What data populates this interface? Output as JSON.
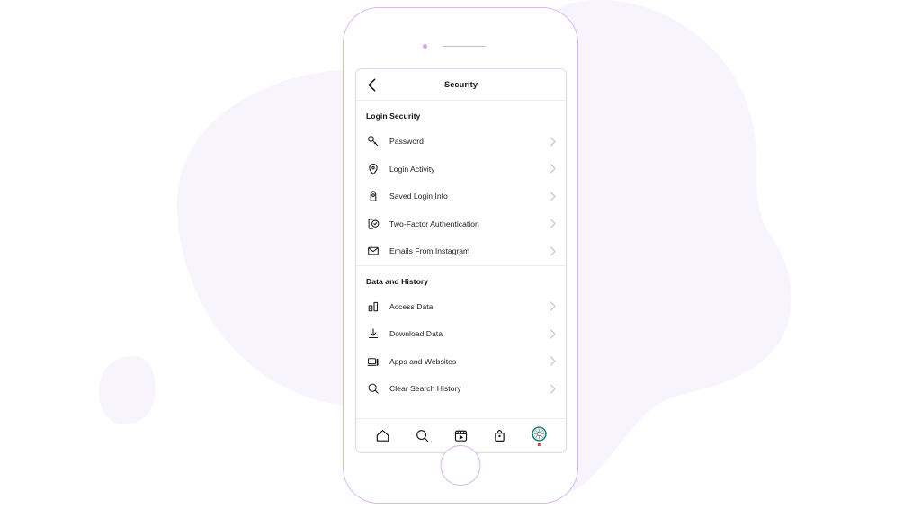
{
  "colors": {
    "background": "#ffffff",
    "blob_fill": "#f8f4fd",
    "phone_outline": "#d8b8f0",
    "screen_outline": "#e5d3f5",
    "text_primary": "#1e1e1e",
    "text_heading": "#121212",
    "chevron": "#cccccc",
    "divider": "#eceaee",
    "avatar_ring": "#14776f",
    "avatar_badge": "#e8383d"
  },
  "device": {
    "name": "smartphone-mockup",
    "camera": "camera-dot",
    "speaker": "speaker-grille",
    "home_button": "home-button"
  },
  "header": {
    "back_icon": "chevron-left-icon",
    "title": "Security"
  },
  "sections": [
    {
      "title": "Login Security",
      "items": [
        {
          "label": "Password",
          "icon": "key-icon",
          "chevron": "chevron-right-icon"
        },
        {
          "label": "Login Activity",
          "icon": "location-pin-icon",
          "chevron": "chevron-right-icon"
        },
        {
          "label": "Saved Login Info",
          "icon": "lock-keyhole-icon",
          "chevron": "chevron-right-icon"
        },
        {
          "label": "Two-Factor Authentication",
          "icon": "phone-shield-check-icon",
          "chevron": "chevron-right-icon"
        },
        {
          "label": "Emails From Instagram",
          "icon": "envelope-icon",
          "chevron": "chevron-right-icon"
        }
      ]
    },
    {
      "title": "Data and History",
      "items": [
        {
          "label": "Access Data",
          "icon": "bar-chart-icon",
          "chevron": "chevron-right-icon"
        },
        {
          "label": "Download Data",
          "icon": "download-icon",
          "chevron": "chevron-right-icon"
        },
        {
          "label": "Apps and Websites",
          "icon": "monitor-icon",
          "chevron": "chevron-right-icon"
        },
        {
          "label": "Clear Search History",
          "icon": "search-icon",
          "chevron": "chevron-right-icon"
        }
      ]
    }
  ],
  "tabbar": {
    "items": [
      {
        "name": "home-tab",
        "icon": "home-icon"
      },
      {
        "name": "search-tab",
        "icon": "search-icon"
      },
      {
        "name": "reels-tab",
        "icon": "reels-play-icon"
      },
      {
        "name": "shop-tab",
        "icon": "shopping-bag-icon"
      },
      {
        "name": "profile-tab",
        "icon": "profile-avatar-icon"
      }
    ]
  }
}
